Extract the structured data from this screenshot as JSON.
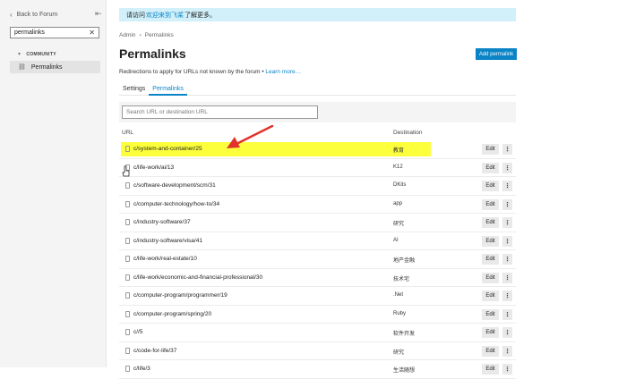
{
  "sidebar": {
    "back_label": "Back to Forum",
    "search_value": "permalinks",
    "section_label": "COMMUNITY",
    "item_label": "Permalinks"
  },
  "banner": {
    "prefix": "请访问",
    "link": "欢迎来到飞桨",
    "suffix": "了解更多。"
  },
  "breadcrumb": {
    "parent": "Admin",
    "current": "Permalinks"
  },
  "page": {
    "title": "Permalinks",
    "add_button": "Add permalink",
    "description": "Redirections to apply for URLs not known by the forum • ",
    "learn_more": "Learn more…"
  },
  "tabs": [
    "Settings",
    "Permalinks"
  ],
  "filter": {
    "placeholder": "Search URL or destination URL"
  },
  "table": {
    "col_url": "URL",
    "col_destination": "Destination",
    "edit_label": "Edit",
    "more_label": "⋮",
    "rows": [
      {
        "url": "c/system-and-container/25",
        "dest": "教育"
      },
      {
        "url": "c/life-work/ai/13",
        "dest": "K12"
      },
      {
        "url": "c/software-development/scm/31",
        "dest": "DKits"
      },
      {
        "url": "c/computer-technology/how-to/34",
        "dest": "app"
      },
      {
        "url": "c/industry-software/37",
        "dest": "研究"
      },
      {
        "url": "c/industry-software/visa/41",
        "dest": "AI"
      },
      {
        "url": "c/life-work/real-estate/10",
        "dest": "地产金融"
      },
      {
        "url": "c/life-work/economic-and-financial-professional/30",
        "dest": "技术宅"
      },
      {
        "url": "c/computer-program/programmer/19",
        "dest": ".Net"
      },
      {
        "url": "c/computer-program/spring/20",
        "dest": "Ruby"
      },
      {
        "url": "c//5",
        "dest": "软件开发"
      },
      {
        "url": "c/code-for-life/37",
        "dest": "研究"
      },
      {
        "url": "c/life/3",
        "dest": "生活随想"
      }
    ]
  },
  "colors": {
    "accent": "#0a84c6",
    "highlight": "#fcff3c",
    "arrow": "#e0332b",
    "banner_bg": "#d1f0fa"
  }
}
